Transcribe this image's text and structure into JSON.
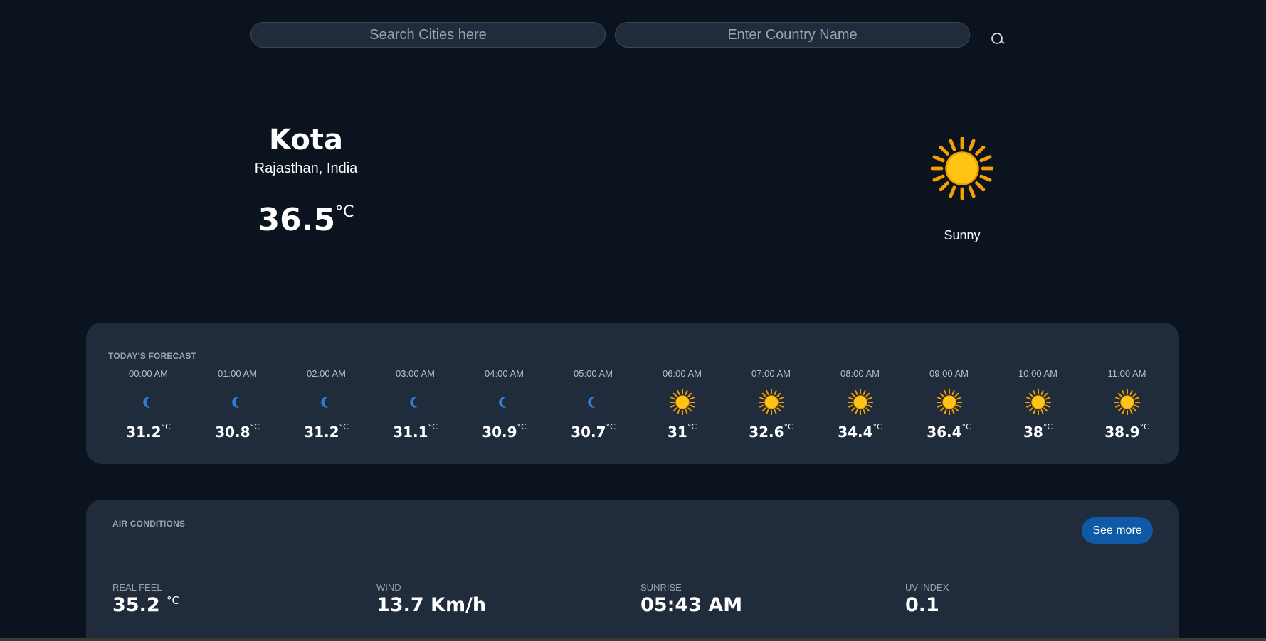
{
  "search": {
    "city_placeholder": "Search Cities here",
    "country_placeholder": "Enter Country Name",
    "button_icon": "search-icon"
  },
  "current": {
    "city": "Kota",
    "region": "Rajasthan, India",
    "temperature": "36.5",
    "unit": "°C",
    "condition": "Sunny",
    "icon": "sun-icon"
  },
  "forecast": {
    "title": "TODAY'S FORECAST",
    "hours": [
      {
        "time": "00:00 AM",
        "icon": "moon-icon",
        "temp": "31.2"
      },
      {
        "time": "01:00 AM",
        "icon": "moon-icon",
        "temp": "30.8"
      },
      {
        "time": "02:00 AM",
        "icon": "moon-icon",
        "temp": "31.2"
      },
      {
        "time": "03:00 AM",
        "icon": "moon-icon",
        "temp": "31.1"
      },
      {
        "time": "04:00 AM",
        "icon": "moon-icon",
        "temp": "30.9"
      },
      {
        "time": "05:00 AM",
        "icon": "moon-icon",
        "temp": "30.7"
      },
      {
        "time": "06:00 AM",
        "icon": "sun-icon",
        "temp": "31"
      },
      {
        "time": "07:00 AM",
        "icon": "sun-icon",
        "temp": "32.6"
      },
      {
        "time": "08:00 AM",
        "icon": "sun-icon",
        "temp": "34.4"
      },
      {
        "time": "09:00 AM",
        "icon": "sun-icon",
        "temp": "36.4"
      },
      {
        "time": "10:00 AM",
        "icon": "sun-icon",
        "temp": "38"
      },
      {
        "time": "11:00 AM",
        "icon": "sun-icon",
        "temp": "38.9"
      }
    ],
    "unit": "°C"
  },
  "air": {
    "title": "AIR CONDITIONS",
    "see_more": "See more",
    "metrics": [
      {
        "label": "REAL FEEL",
        "value": "35.2",
        "unit": "°C"
      },
      {
        "label": "WIND",
        "value": "13.7 Km/h",
        "unit": ""
      },
      {
        "label": "SUNRISE",
        "value": "05:43 AM",
        "unit": ""
      },
      {
        "label": "UV INDEX",
        "value": "0.1",
        "unit": ""
      }
    ]
  },
  "colors": {
    "background": "#0b131e",
    "panel": "#202b3b",
    "accent": "#0e5aa7",
    "sun": "#ffc414",
    "moon": "#2f7fd6"
  }
}
